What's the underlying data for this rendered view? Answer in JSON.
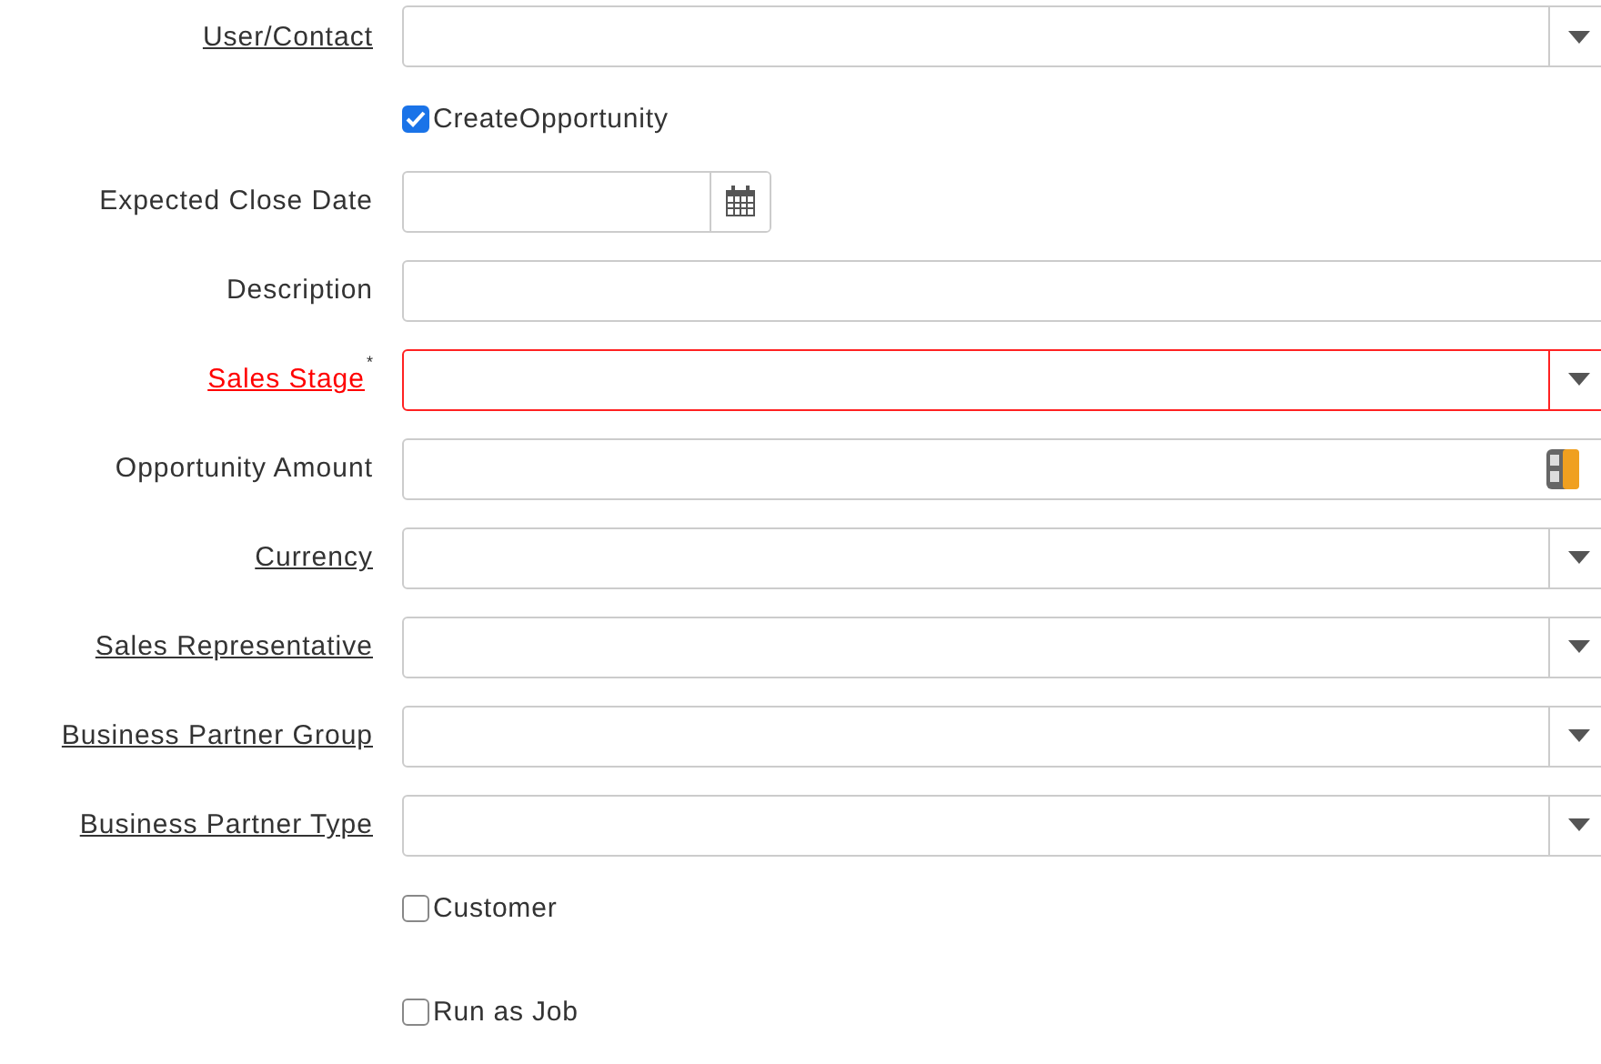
{
  "fields": [
    {
      "kind": "select",
      "label": "User/Contact",
      "linked": true,
      "mandatory": false
    },
    {
      "kind": "checkbox",
      "label": "CreateOpportunity",
      "checked": true
    },
    {
      "kind": "date",
      "label": "Expected Close Date",
      "linked": false,
      "mandatory": false
    },
    {
      "kind": "text",
      "label": "Description",
      "linked": false,
      "mandatory": false
    },
    {
      "kind": "select",
      "label": "Sales Stage",
      "linked": true,
      "mandatory": true,
      "mandatory_mark": "*"
    },
    {
      "kind": "number",
      "label": "Opportunity Amount",
      "linked": false,
      "mandatory": false
    },
    {
      "kind": "select",
      "label": "Currency",
      "linked": true,
      "mandatory": false
    },
    {
      "kind": "select",
      "label": "Sales Representative",
      "linked": true,
      "mandatory": false
    },
    {
      "kind": "select",
      "label": "Business Partner Group",
      "linked": true,
      "mandatory": false
    },
    {
      "kind": "select",
      "label": "Business Partner Type",
      "linked": true,
      "mandatory": false
    },
    {
      "kind": "checkbox",
      "label": "Customer",
      "checked": false
    },
    {
      "kind": "checkbox",
      "label": "Run as Job",
      "checked": false,
      "separated": true
    }
  ]
}
